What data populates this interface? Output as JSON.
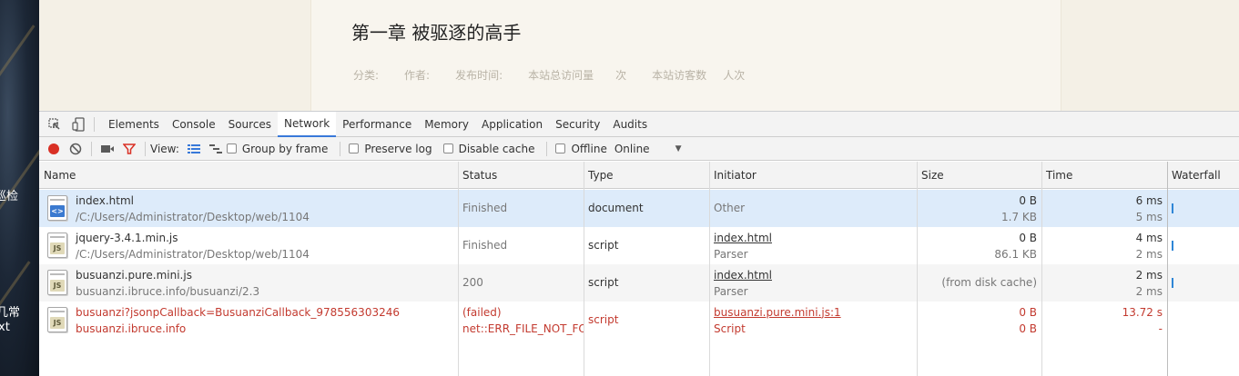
{
  "background": {
    "side_text": [
      "巡检",
      "几常",
      "xt"
    ]
  },
  "article": {
    "title": "第一章 被驱逐的高手",
    "meta": [
      "分类:",
      "作者:",
      "发布时间:",
      "本站总访问量",
      "次",
      "本站访客数",
      "人次"
    ]
  },
  "devtools": {
    "tabs": [
      "Elements",
      "Console",
      "Sources",
      "Network",
      "Performance",
      "Memory",
      "Application",
      "Security",
      "Audits"
    ],
    "active_tab": "Network",
    "toolbar": {
      "view_label": "View:",
      "group_by_frame": "Group by frame",
      "preserve_log": "Preserve log",
      "disable_cache": "Disable cache",
      "offline": "Offline",
      "throttle": "Online"
    },
    "columns": {
      "name": "Name",
      "status": "Status",
      "type": "Type",
      "initiator": "Initiator",
      "size": "Size",
      "time": "Time",
      "waterfall": "Waterfall"
    },
    "rows": [
      {
        "icon": "html-file-icon",
        "badge": "<>",
        "name": "index.html",
        "path": "/C:/Users/Administrator/Desktop/web/1104",
        "status": "Finished",
        "status2": "",
        "type": "document",
        "initiator": "Other",
        "initiator2": "",
        "size": "0 B",
        "size2": "1.7 KB",
        "time": "6 ms",
        "time2": "5 ms",
        "selected": true,
        "failed": false
      },
      {
        "icon": "js-file-icon",
        "badge": "JS",
        "name": "jquery-3.4.1.min.js",
        "path": "/C:/Users/Administrator/Desktop/web/1104",
        "status": "Finished",
        "status2": "",
        "type": "script",
        "initiator": "index.html",
        "initiator2": "Parser",
        "size": "0 B",
        "size2": "86.1 KB",
        "time": "4 ms",
        "time2": "2 ms",
        "selected": false,
        "failed": false
      },
      {
        "icon": "js-file-icon",
        "badge": "JS",
        "name": "busuanzi.pure.mini.js",
        "path": "busuanzi.ibruce.info/busuanzi/2.3",
        "status": "200",
        "status2": "",
        "type": "script",
        "initiator": "index.html",
        "initiator2": "Parser",
        "size": "(from disk cache)",
        "size2": "",
        "time": "2 ms",
        "time2": "2 ms",
        "selected": false,
        "failed": false
      },
      {
        "icon": "js-file-icon",
        "badge": "JS",
        "name": "busuanzi?jsonpCallback=BusuanziCallback_978556303246",
        "path": "busuanzi.ibruce.info",
        "status": "(failed)",
        "status2": "net::ERR_FILE_NOT_FO...",
        "type": "script",
        "initiator": "busuanzi.pure.mini.js:1",
        "initiator2": "Script",
        "size": "0 B",
        "size2": "0 B",
        "time": "13.72 s",
        "time2": "-",
        "selected": false,
        "failed": true
      }
    ],
    "colors": {
      "selected_row": "#ddebfa",
      "alt_row": "#f5f5f5",
      "error_text": "#c33a2f",
      "record_button": "#d93025",
      "filter_icon": "#d93025",
      "active_accent": "#3879d9"
    }
  }
}
